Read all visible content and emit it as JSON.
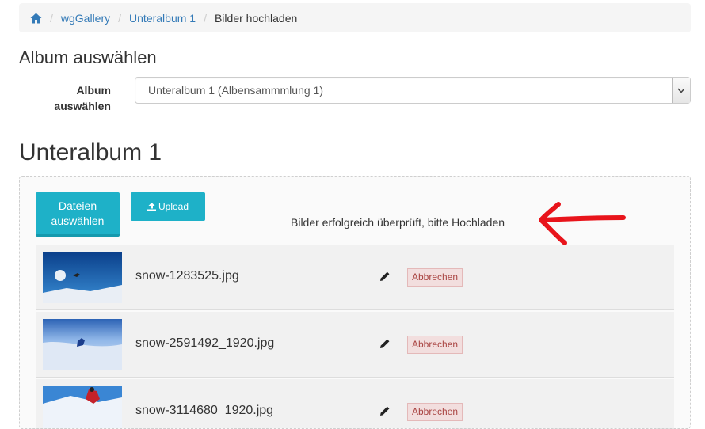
{
  "breadcrumb": {
    "home_icon": "home-icon",
    "items": [
      "wgGallery",
      "Unteralbum 1"
    ],
    "active": "Bilder hochladen"
  },
  "album_section": {
    "heading": "Album auswählen",
    "label": "Album auswählen",
    "selected": "Unteralbum 1 (Albensammmlung 1)"
  },
  "album_title": "Unteralbum 1",
  "upload": {
    "choose_files_label": "Dateien auswählen",
    "upload_label": "Upload",
    "upload_icon": "upload-icon",
    "status": "Bilder erfolgreich überprüft, bitte Hochladen",
    "accent_color": "#1eb1c8"
  },
  "files": [
    {
      "name": "snow-1283525.jpg",
      "cancel_label": "Abbrechen"
    },
    {
      "name": "snow-2591492_1920.jpg",
      "cancel_label": "Abbrechen"
    },
    {
      "name": "snow-3114680_1920.jpg",
      "cancel_label": "Abbrechen"
    }
  ]
}
